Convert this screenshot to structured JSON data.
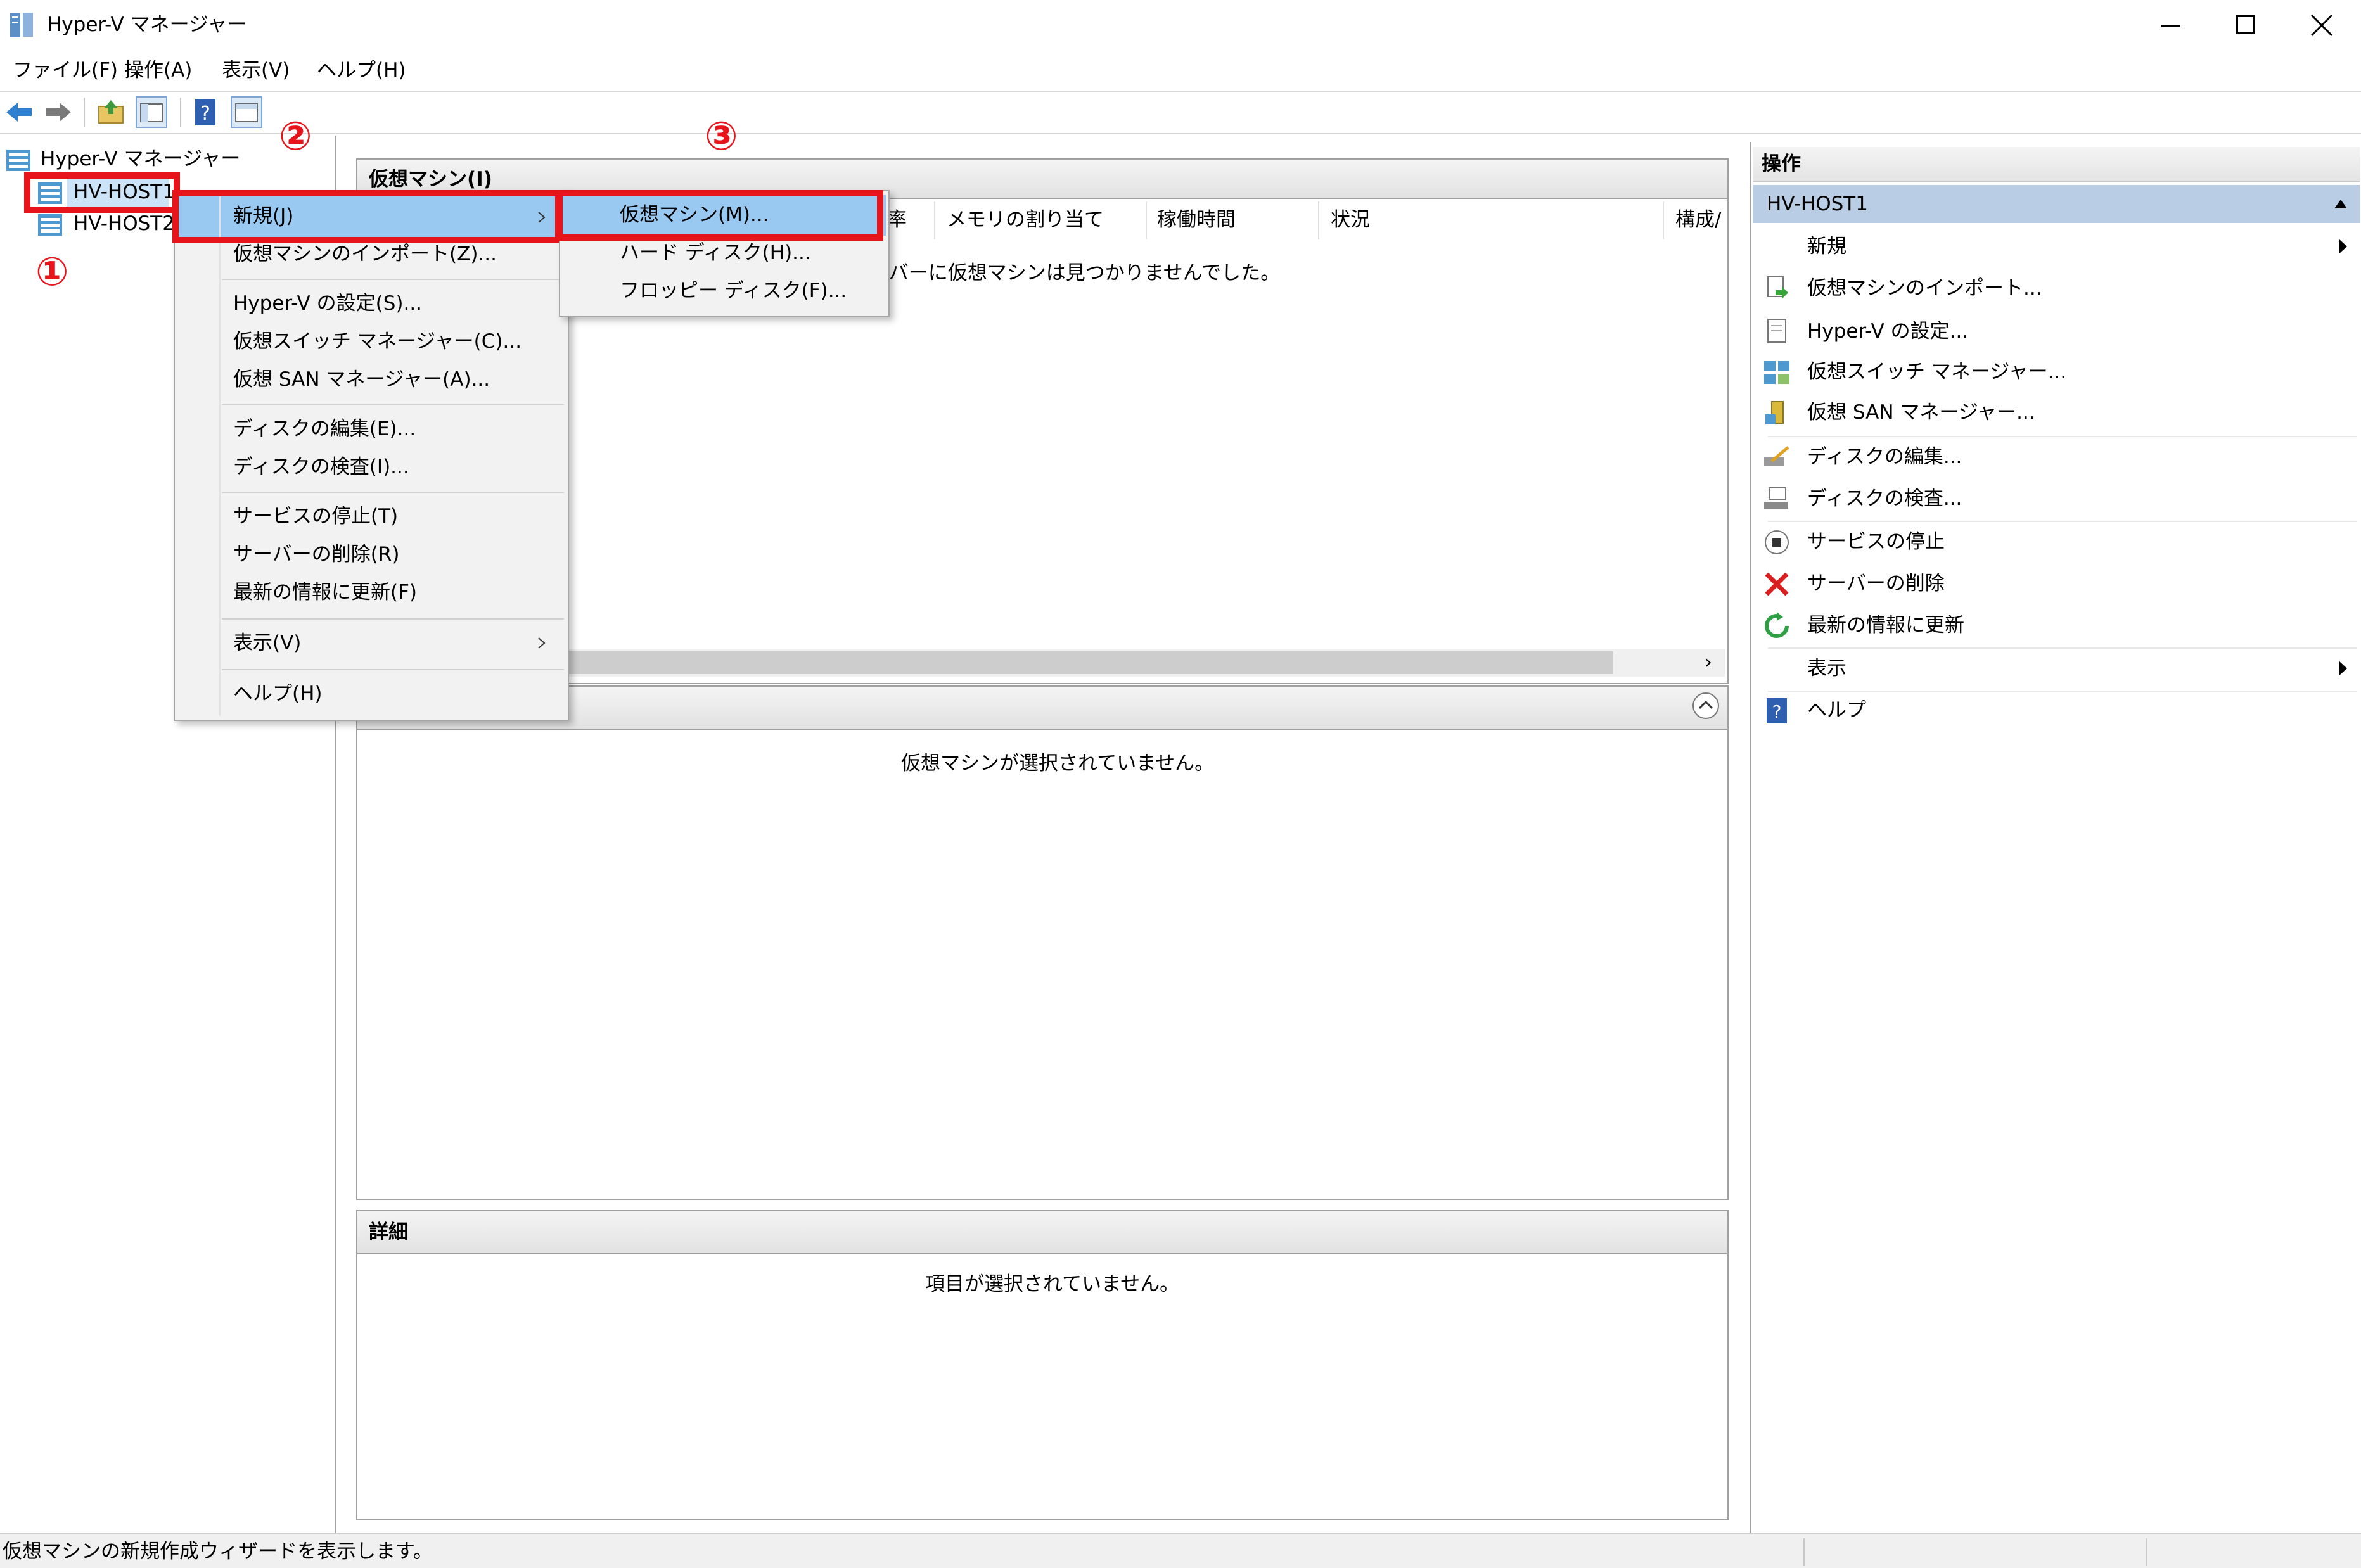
{
  "window": {
    "title": "Hyper-V マネージャー",
    "minimize_icon": "minimize-icon",
    "maximize_icon": "maximize-icon",
    "close_icon": "close-icon"
  },
  "menubar": {
    "file": "ファイル(F)",
    "action": "操作(A)",
    "view": "表示(V)",
    "help": "ヘルプ(H)"
  },
  "toolbar": {
    "icons": [
      "back-arrow-icon",
      "forward-arrow-icon",
      "up-folder-icon",
      "show-hide-console-tree-icon",
      "help-icon",
      "show-hide-action-pane-icon"
    ]
  },
  "tree": {
    "root": "Hyper-V マネージャー",
    "hosts": [
      "HV-HOST1",
      "HV-HOST2"
    ]
  },
  "vm_panel": {
    "title": "仮想マシン(I)",
    "columns": [
      "率",
      "メモリの割り当て",
      "稼働時間",
      "状況",
      "構成/"
    ],
    "empty_message": "ーバーに仮想マシンは見つかりませんでした。"
  },
  "snapshot_panel": {
    "empty_message": "仮想マシンが選択されていません。"
  },
  "details_panel": {
    "title": "詳細",
    "empty_message": "項目が選択されていません。"
  },
  "actions": {
    "header": "操作",
    "host": "HV-HOST1",
    "items": [
      {
        "label": "新規",
        "icon": "none",
        "submenu": true
      },
      {
        "label": "仮想マシンのインポート...",
        "icon": "import-icon"
      },
      {
        "label": "Hyper-V の設定...",
        "icon": "settings-page-icon"
      },
      {
        "label": "仮想スイッチ マネージャー...",
        "icon": "virtual-switch-icon"
      },
      {
        "label": "仮想 SAN マネージャー...",
        "icon": "san-manager-icon"
      },
      {
        "label": "ディスクの編集...",
        "icon": "edit-disk-icon"
      },
      {
        "label": "ディスクの検査...",
        "icon": "inspect-disk-icon"
      },
      {
        "label": "サービスの停止",
        "icon": "stop-service-icon"
      },
      {
        "label": "サーバーの削除",
        "icon": "remove-server-icon"
      },
      {
        "label": "最新の情報に更新",
        "icon": "refresh-icon"
      },
      {
        "label": "表示",
        "icon": "none",
        "submenu": true
      },
      {
        "label": "ヘルプ",
        "icon": "help-icon"
      }
    ]
  },
  "context_menu": {
    "items": [
      "新規(J)",
      "仮想マシンのインポート(Z)...",
      "Hyper-V の設定(S)...",
      "仮想スイッチ マネージャー(C)...",
      "仮想 SAN マネージャー(A)...",
      "ディスクの編集(E)...",
      "ディスクの検査(I)...",
      "サービスの停止(T)",
      "サーバーの削除(R)",
      "最新の情報に更新(F)",
      "表示(V)",
      "ヘルプ(H)"
    ]
  },
  "submenu": {
    "items": [
      "仮想マシン(M)...",
      "ハード ディスク(H)...",
      "フロッピー ディスク(F)..."
    ]
  },
  "annotations": {
    "step1": "①",
    "step2": "②",
    "step3": "③",
    "color": "#e8141c"
  },
  "statusbar": {
    "text": "仮想マシンの新規作成ウィザードを表示します。"
  },
  "colors": {
    "selection_blue": "#99c9f0",
    "action_header_blue": "#b9cde5",
    "annotation_red": "#e8141c"
  }
}
